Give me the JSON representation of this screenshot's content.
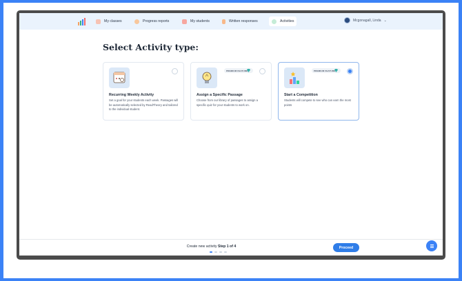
{
  "nav": {
    "items": [
      {
        "label": "My classes",
        "icon": "classes-icon",
        "color": "#f26b6b"
      },
      {
        "label": "Progress reports",
        "icon": "progress-icon",
        "color": "#f6a261"
      },
      {
        "label": "My students",
        "icon": "students-icon",
        "color": "#f26b6b"
      },
      {
        "label": "Written responses",
        "icon": "written-icon",
        "color": "#f6a261"
      },
      {
        "label": "Activities",
        "icon": "activities-icon",
        "color": "#38b27a",
        "active": true
      }
    ],
    "user": "Mcgonagall, Linda"
  },
  "page": {
    "title": "Select Activity type:"
  },
  "cards": [
    {
      "title": "Recurring Weekly Activity",
      "description": "Set a goal for your students each week. Passages will be automatically selected by ReadTheory and tailored to the individual student.",
      "selected": false
    },
    {
      "title": "Assign a Specific Passage",
      "description": "Choose from our library of passages to assign a specific quiz for your students to work on.",
      "badge": "PREMIUM FEATURE",
      "selected": false
    },
    {
      "title": "Start a Competition",
      "description": "Students will compete to see who can earn the most points",
      "badge": "PREMIUM FEATURE",
      "selected": true
    }
  ],
  "footer": {
    "step_prefix": "Create new activity",
    "step_label": "Step 1 of 4",
    "current_step": 1,
    "total_steps": 4,
    "proceed_label": "Proceed"
  },
  "colors": {
    "accent": "#3b82f6",
    "nav_bg": "#eaf3fd"
  }
}
